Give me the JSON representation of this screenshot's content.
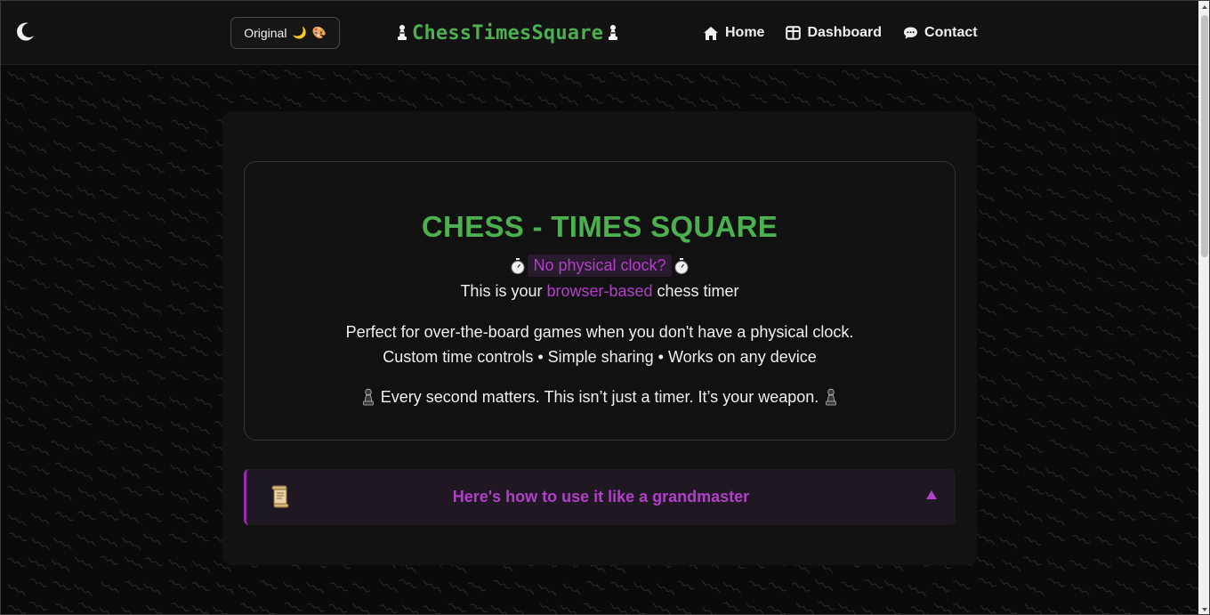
{
  "header": {
    "theme_button": {
      "label": "Original",
      "emoji1": "🌙",
      "emoji2": "🎨"
    },
    "brand": "ChessTimesSquare",
    "nav": [
      {
        "label": "Home",
        "icon": "home-icon"
      },
      {
        "label": "Dashboard",
        "icon": "dashboard-icon"
      },
      {
        "label": "Contact",
        "icon": "chat-icon"
      }
    ]
  },
  "hero": {
    "title": "CHESS - TIMES SQUARE",
    "tagline": "No physical clock?",
    "line2_prefix": "This is your ",
    "line2_accent": "browser-based",
    "line2_suffix": " chess timer",
    "desc1": "Perfect for over-the-board games when you don't have a physical clock.",
    "desc2": "Custom time controls • Simple sharing • Works on any device",
    "motto": "Every second matters. This isn’t just a timer. It’s your weapon."
  },
  "accordion": {
    "title": "Here's how to use it like a grandmaster"
  },
  "colors": {
    "brand_green": "#4caf50",
    "accent_purple": "#b040c8",
    "background": "#0b0b0b"
  }
}
